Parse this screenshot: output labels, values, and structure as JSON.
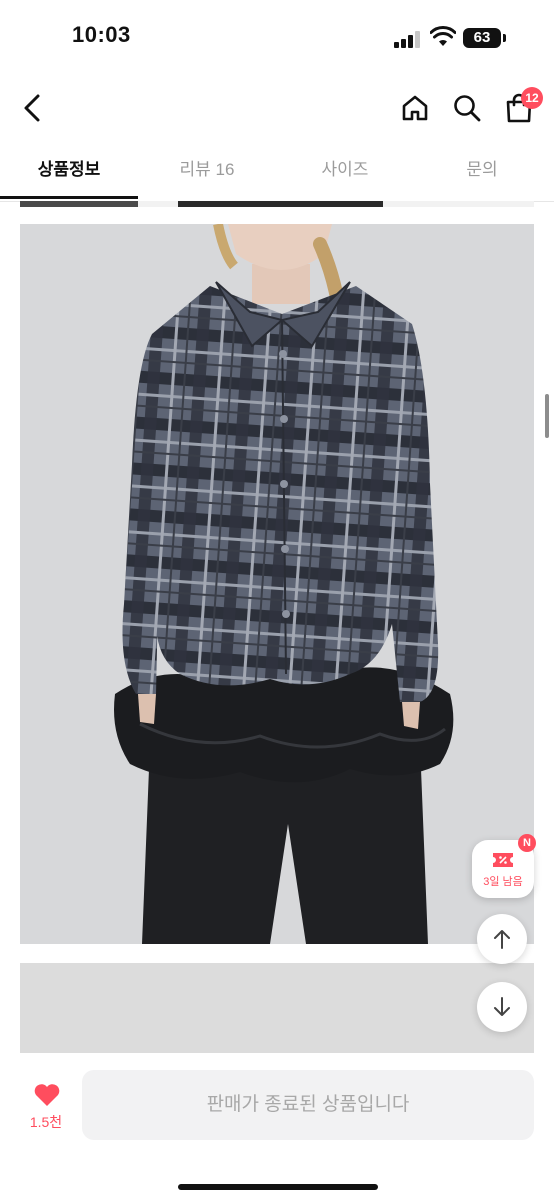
{
  "status_bar": {
    "time": "10:03",
    "battery": "63"
  },
  "header": {
    "back_icon": "chevron-left-icon",
    "home_icon": "home-icon",
    "search_icon": "search-icon",
    "cart_icon": "shopping-bag-icon",
    "cart_count": "12"
  },
  "tabs": [
    {
      "label": "상품정보",
      "active": true
    },
    {
      "label": "리뷰 16",
      "active": false
    },
    {
      "label": "사이즈",
      "active": false
    },
    {
      "label": "문의",
      "active": false
    }
  ],
  "floating": {
    "coupon_badge": "N",
    "coupon_label": "3일 남음",
    "coupon_icon": "ticket-icon",
    "scroll_up_icon": "arrow-up-icon",
    "scroll_down_icon": "arrow-down-icon"
  },
  "bottom_bar": {
    "like_icon": "heart-icon",
    "like_count": "1.5천",
    "sold_out_label": "판매가 종료된 상품입니다"
  },
  "colors": {
    "accent": "#ff4d5e",
    "text": "#111111",
    "muted": "#9b9b9b"
  }
}
